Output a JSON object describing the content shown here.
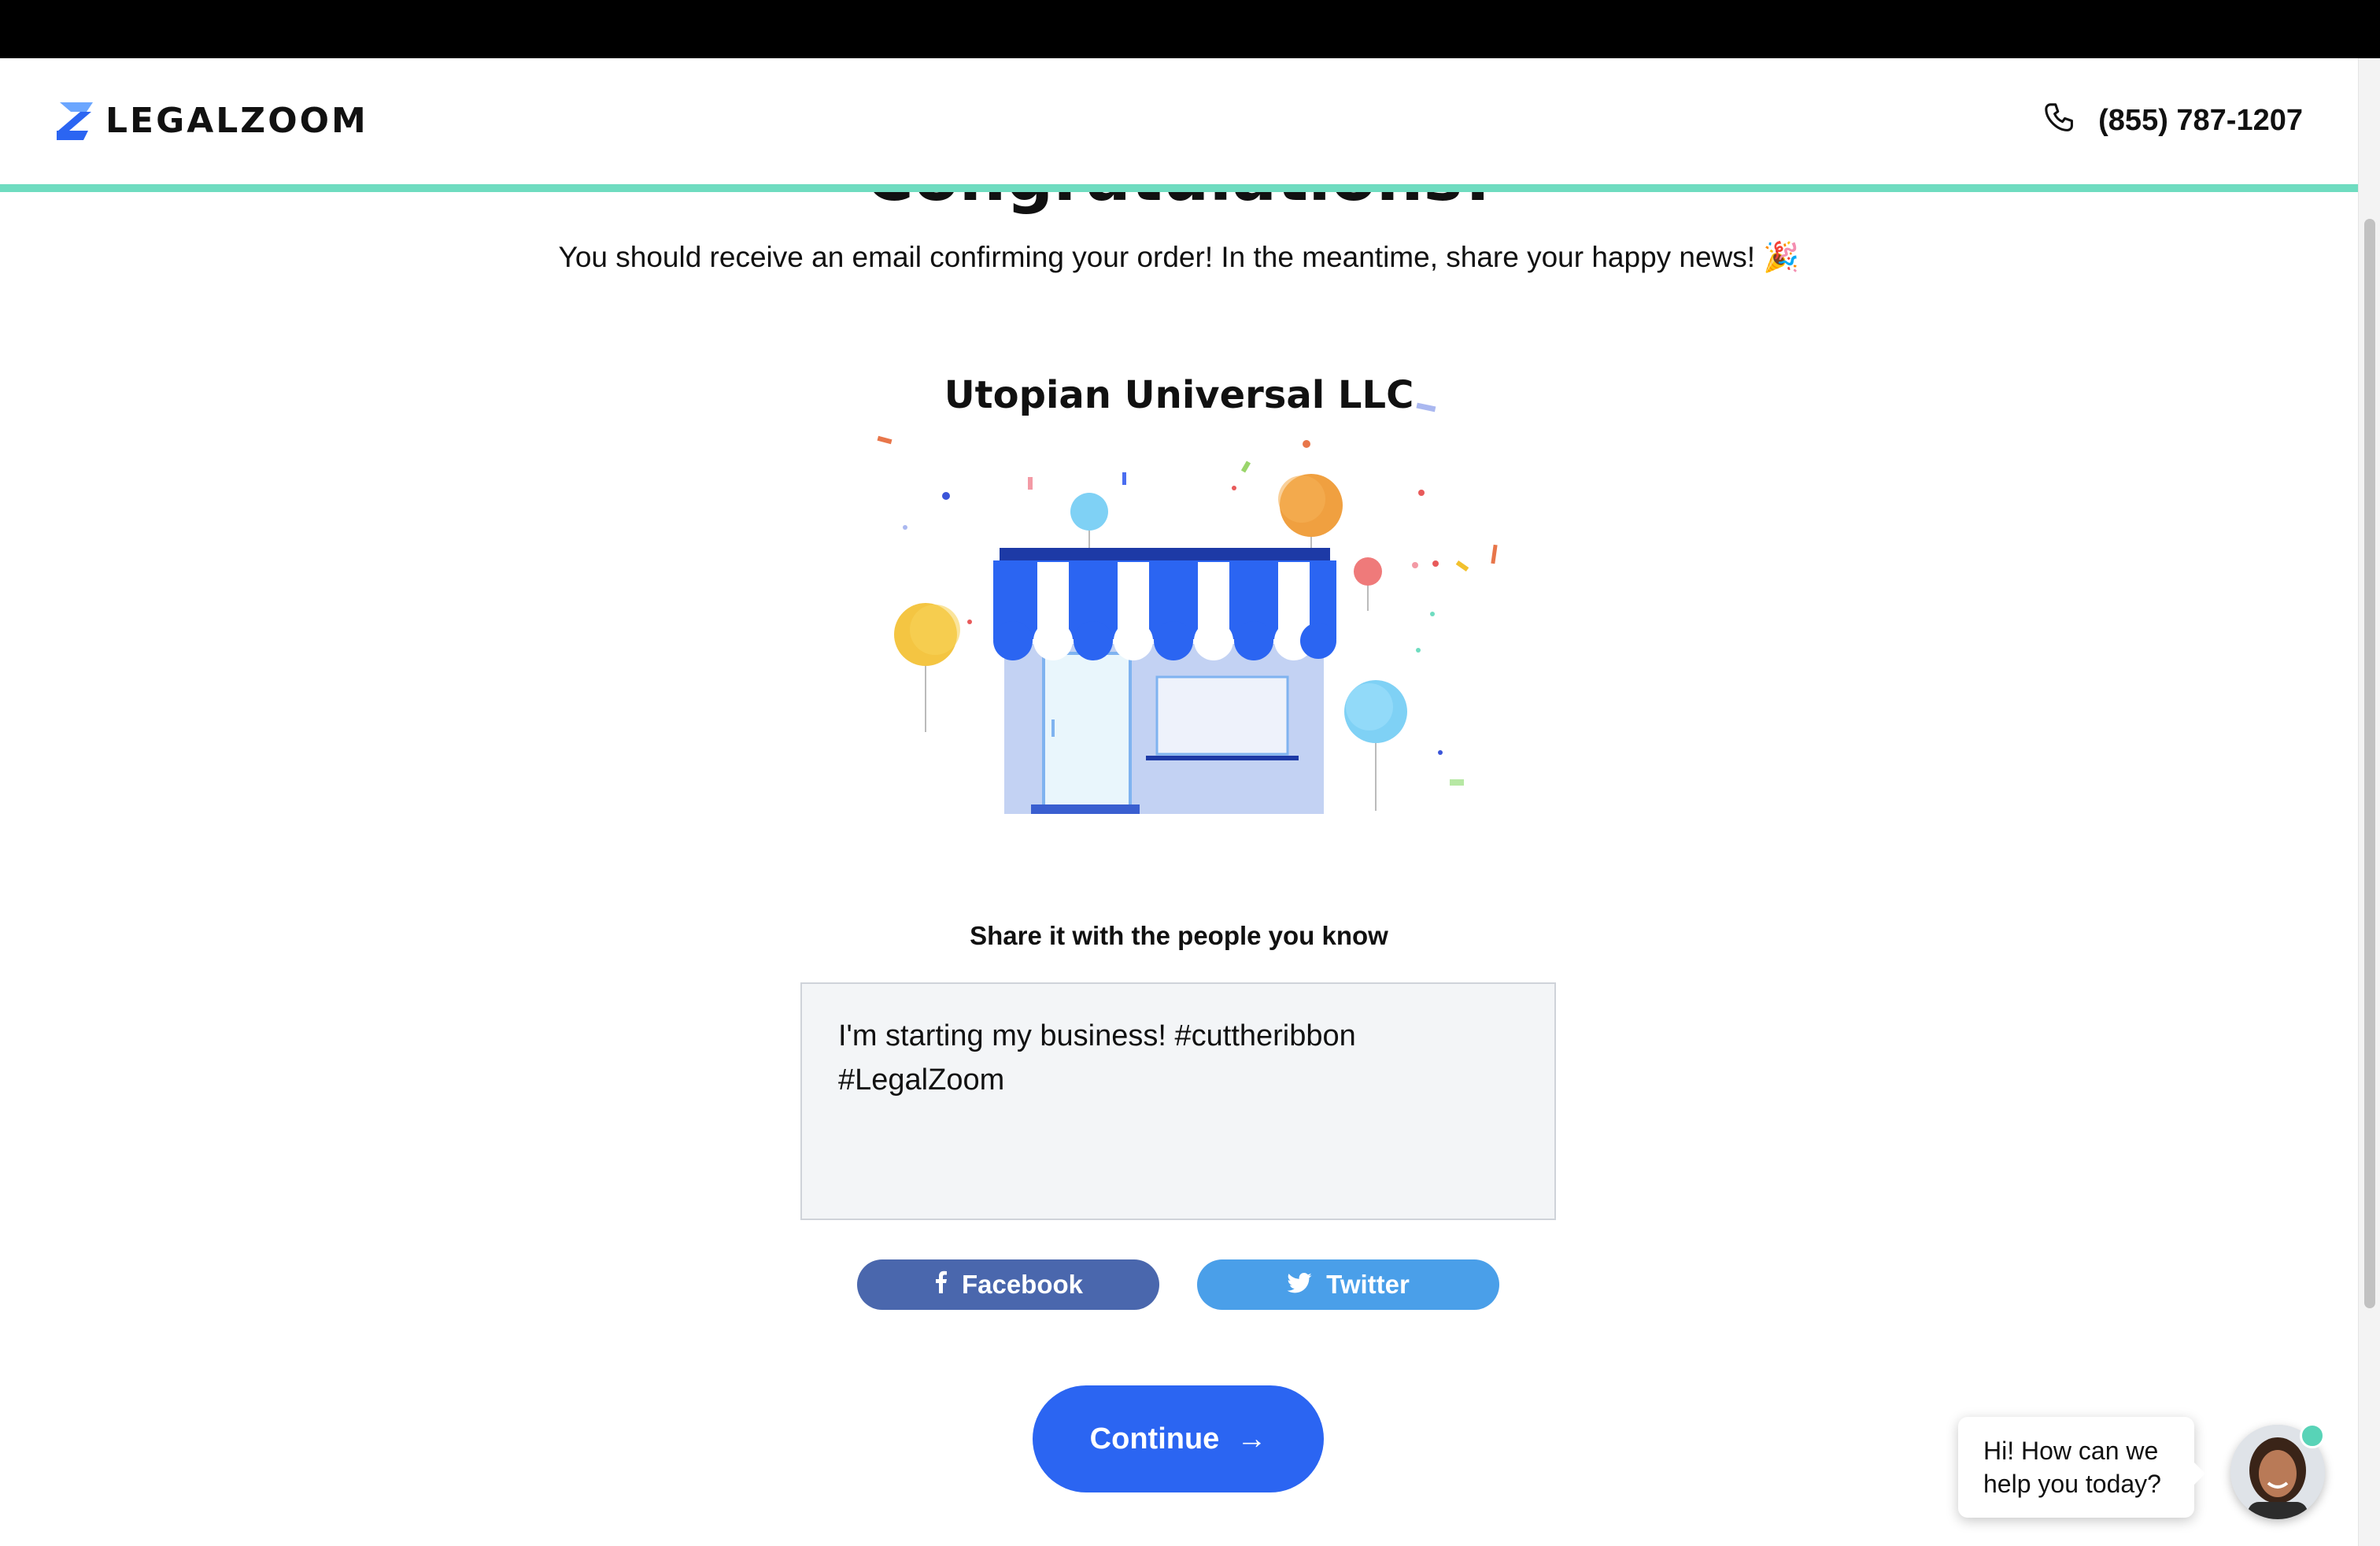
{
  "header": {
    "logo_text": "LEGALZOOM",
    "phone": "(855) 787-1207"
  },
  "main": {
    "title": "Congratulations!",
    "subtitle": "You should receive an email confirming your order! In the meantime, share your happy news! 🎉",
    "business_name": "Utopian Universal LLC",
    "share_label": "Share it with the people you know",
    "share_message_line1": "I'm starting my business! #cuttheribbon",
    "share_message_line2": "#LegalZoom",
    "facebook_label": "Facebook",
    "twitter_label": "Twitter",
    "continue_label": "Continue"
  },
  "chat": {
    "line1": "Hi! How can we",
    "line2": "help you today?"
  },
  "colors": {
    "brand_blue": "#2b65f2",
    "accent_teal": "#6fdcc0",
    "facebook": "#4a67ad",
    "twitter": "#4a9fe9"
  }
}
